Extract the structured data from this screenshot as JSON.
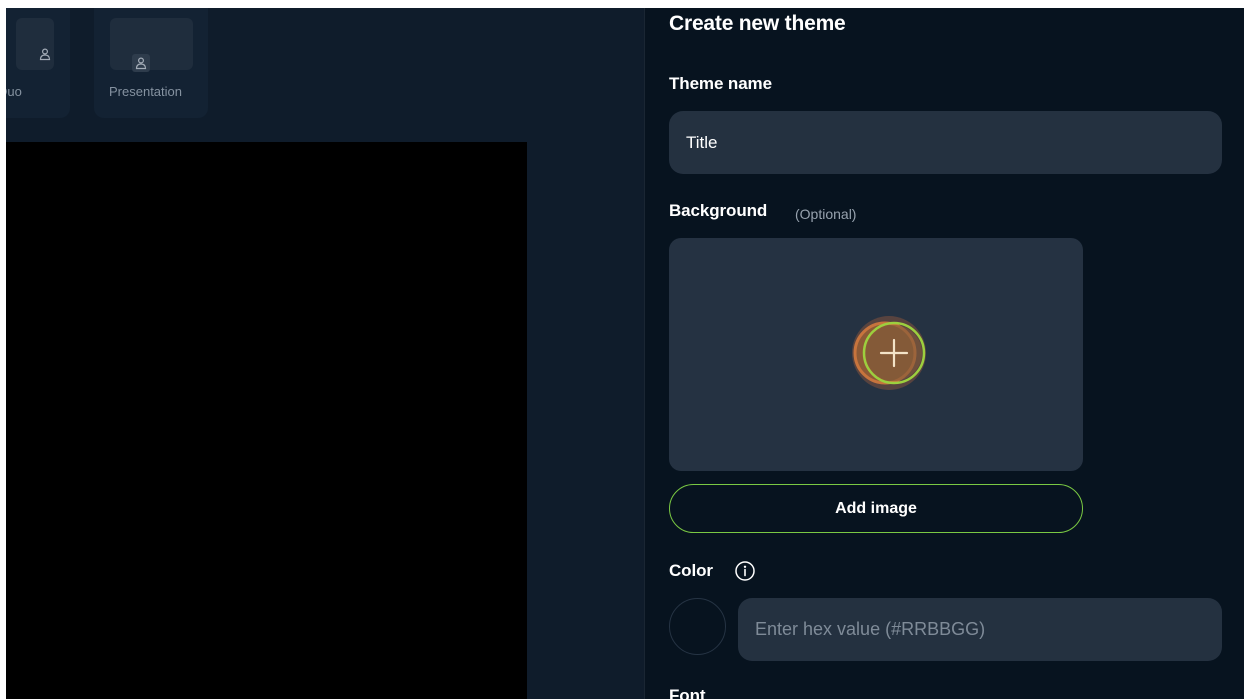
{
  "layouts": [
    {
      "label": "Duo",
      "icon": "person-icon"
    },
    {
      "label": "Presentation",
      "icon": "person-icon"
    }
  ],
  "panel": {
    "title": "Create new theme",
    "theme_name": {
      "label": "Theme name",
      "value": "Title"
    },
    "background": {
      "label": "Background",
      "optional": "(Optional)",
      "upload_icon": "plus-icon",
      "add_button": "Add image"
    },
    "color": {
      "label": "Color",
      "info_icon": "info-icon",
      "hex_placeholder": "Enter hex value (#RRBBGG)",
      "swatch_color": "#07131f"
    },
    "font": {
      "label": "Font"
    }
  },
  "colors": {
    "accent_green": "#7ac943",
    "upload_orange": "#c7743d",
    "panel_bg": "#07131f",
    "input_bg": "#243140"
  }
}
